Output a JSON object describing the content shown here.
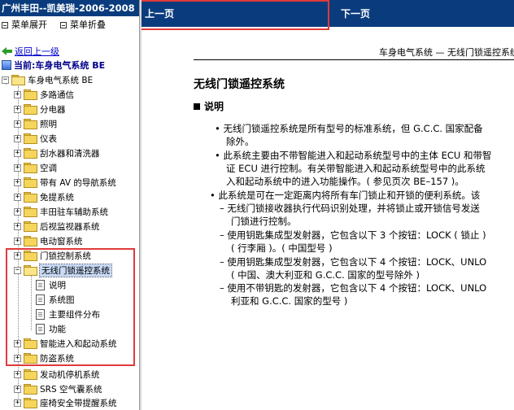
{
  "left": {
    "title": "广州丰田--凯美瑞-2006-2008",
    "toolbar": {
      "expand": "菜单展开",
      "collapse": "菜单折叠"
    },
    "back": "返回上一级",
    "current": "当前:车身电气系统 BE",
    "root": "车身电气系统 BE",
    "items": [
      "多路通信",
      "分电器",
      "照明",
      "仪表",
      "刮水器和清洗器",
      "空调",
      "带有 AV 的导航系统",
      "免提系统",
      "丰田驻车辅助系统",
      "后视监视器系统",
      "电动窗系统",
      "门锁控制系统",
      "无线门锁遥控系统",
      "智能进入和起动系统",
      "防盗系统",
      "发动机停机系统",
      "SRS 空气囊系统",
      "座椅安全带提醒系统"
    ],
    "children": [
      "说明",
      "系统图",
      "主要组件分布",
      "功能"
    ]
  },
  "right": {
    "prev": "上一页",
    "next": "下一页",
    "header": "车身电气系统 — 无线门锁遥控系统",
    "title": "无线门锁遥控系统",
    "section": "说明",
    "lines": [
      "• 无线门锁遥控系统是所有型号的标准系统，但 G.C.C. 国家配备",
      "除外。",
      "• 此系统主要由不带智能进入和起动系统型号中的主体 ECU 和带智",
      "证 ECU 进行控制。有关带智能进入和起动系统型号中的此系统",
      "入和起动系统中的进入功能操作。( 参见页次 BE–157 )。",
      "• 此系统是可在一定距离内将所有车门锁止和开锁的便利系统。该",
      "– 无线门锁接收器执行代码识别处理，并将锁止或开锁信号发送",
      "门锁进行控制。",
      "– 使用钥匙集成型发射器，它包含以下 3 个按钮：LOCK ( 锁止 )",
      "( 行李厢 )。( 中国型号 )",
      "– 使用钥匙集成型发射器，它包含以下 4 个按钮：LOCK、UNLO",
      "( 中国、澳大利亚和 G.C.C. 国家的型号除外 )",
      "– 使用不带钥匙的发射器，它包含以下 4 个按钮：LOCK、UNLO",
      "利亚和 G.C.C. 国家的型号 )"
    ]
  }
}
